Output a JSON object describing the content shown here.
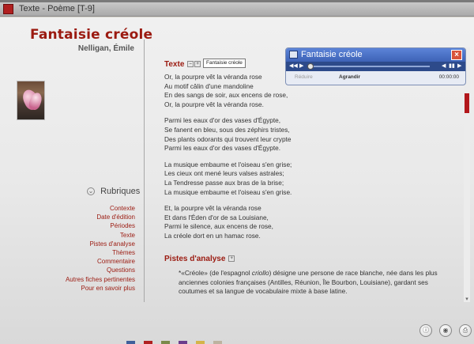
{
  "window": {
    "title": "Texte - Poème [T-9]"
  },
  "poem": {
    "title": "Fantaisie créole",
    "author": "Nelligan, Émile"
  },
  "rubriques": {
    "label": "Rubriques",
    "items": [
      {
        "label": "Contexte"
      },
      {
        "label": "Date d'édition"
      },
      {
        "label": "Périodes"
      },
      {
        "label": "Texte"
      },
      {
        "label": "Pistes d'analyse"
      },
      {
        "label": "Thèmes"
      },
      {
        "label": "Commentaire"
      },
      {
        "label": "Questions"
      },
      {
        "label": "Autres fiches pertinentes"
      },
      {
        "label": "Pour en savoir plus"
      }
    ]
  },
  "texte": {
    "heading": "Texte",
    "tag": "Fantaisie créole",
    "stanzas": [
      {
        "lines": [
          {
            "t": "Or, la pourpre vêt la véranda rose"
          },
          {
            "t": "Au motif câlin d'une mandoline"
          },
          {
            "t": "En des sangs de soir, aux encens de rose,"
          },
          {
            "t": "Or, la pourpre vêt la véranda rose."
          }
        ]
      },
      {
        "lines": [
          {
            "t": "Parmi les eaux d'or des vases d'Égypte,"
          },
          {
            "t": "Se fanent en bleu, sous des zéphirs tristes,"
          },
          {
            "t": "Des plants odorants qui trouvent leur crypte"
          },
          {
            "t": "Parmi les eaux d'or des vases d'Égypte."
          }
        ]
      },
      {
        "lines": [
          {
            "t": "La musique embaume et l'oiseau s'en grise;"
          },
          {
            "t": "Les cieux ont mené leurs valses astrales;"
          },
          {
            "t": "La Tendresse passe aux bras de la brise;"
          },
          {
            "t": "La musique embaume et l'oiseau s'en grise."
          }
        ]
      },
      {
        "lines": [
          {
            "t": "Et, la pourpre vêt la véranda rose"
          },
          {
            "t": "Et dans l'Éden d'or de sa Louisiane,"
          },
          {
            "t": "Parmi le silence, aux encens de rose,"
          },
          {
            "t": "La créole dort en un hamac rose."
          }
        ]
      }
    ]
  },
  "pistes": {
    "heading": "Pistes d'analyse",
    "note_prefix": "*«Créole» (de l'espagnol ",
    "note_italic": "criollo",
    "note_suffix": ") désigne une persone de race blanche, née dans les plus anciennes colonies françaises (Antilles, Réunion, Île Bourbon, Louisiane), gardant ses coutumes et sa langue de vocabulaire mixte à base latine."
  },
  "player": {
    "title": "Fantaisie créole",
    "reduire": "Réduire",
    "agrandir": "Agrandir",
    "time": "00:00:00",
    "progress": 0
  },
  "bottom_icons": [
    {
      "name": "info-icon",
      "glyph": "ⓘ"
    },
    {
      "name": "sound-icon",
      "glyph": "◉"
    },
    {
      "name": "print-icon",
      "glyph": "⎙"
    }
  ],
  "colors": {
    "accent": "#9b1a10",
    "swatches": [
      "#3f5f9b",
      "#b02020",
      "#7a8a4a",
      "#6b3d8c",
      "#d4b44a",
      "#bdb3a0"
    ]
  }
}
